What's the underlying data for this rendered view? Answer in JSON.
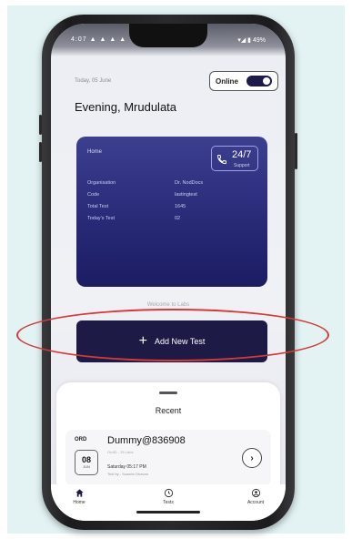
{
  "status_bar": {
    "left": "4:07 ▲ ▲ ▲ ▲",
    "right": "▾◢ ▮ 49%"
  },
  "header": {
    "date": "Today, 05 June",
    "greeting": "Evening, Mrudulata",
    "online_label": "Online"
  },
  "card": {
    "title": "Home",
    "support_main": "24/7",
    "support_sub": "Support",
    "rows": [
      {
        "key": "Organisation",
        "value": "Dr. NodDocs"
      },
      {
        "key": "Code",
        "value": "lastingtest"
      },
      {
        "key": "Total Test",
        "value": "1645"
      },
      {
        "key": "Today's Test",
        "value": "02"
      }
    ]
  },
  "welcome_text": "Welcome to Labs",
  "add_button": {
    "icon": "+",
    "label": "Add New Test"
  },
  "recent": {
    "title": "Recent",
    "item": {
      "ord": "ORD",
      "day": "08",
      "month": "JUN",
      "name": "Dummy@836908",
      "sub1": "OrdID - 25 Labs",
      "sub2": "Saturday 05:17 PM",
      "sub3": "Test by - Soaahn Dhavan",
      "arrow": "›"
    }
  },
  "nav": [
    {
      "label": "Home",
      "icon": "home-icon"
    },
    {
      "label": "Tests",
      "icon": "clock-icon"
    },
    {
      "label": "Account",
      "icon": "account-icon"
    }
  ],
  "colors": {
    "primary": "#1d1a45",
    "card_top": "#3c3f8f",
    "card_bottom": "#1b1c62",
    "highlight": "#d33a3a",
    "background": "#e3f3f4"
  }
}
